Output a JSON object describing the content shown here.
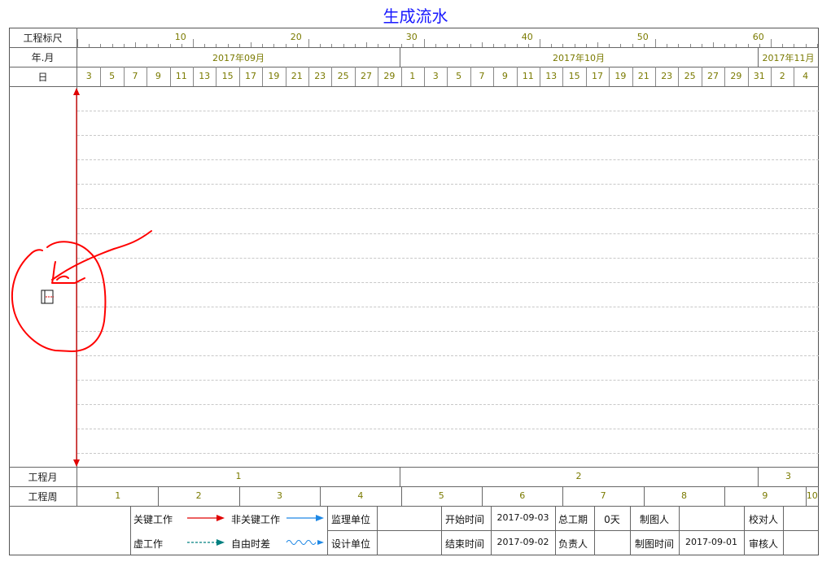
{
  "title": "生成流水",
  "row_labels": {
    "scale": "工程标尺",
    "year_month": "年.月",
    "day": "日",
    "project_month": "工程月",
    "project_week": "工程周"
  },
  "scale_ticks": [
    "10",
    "20",
    "30",
    "40",
    "50",
    "60"
  ],
  "months": [
    "2017年09月",
    "2017年10月",
    "2017年11月"
  ],
  "days": [
    "3",
    "5",
    "7",
    "9",
    "11",
    "13",
    "15",
    "17",
    "19",
    "21",
    "23",
    "25",
    "27",
    "29",
    "1",
    "3",
    "5",
    "7",
    "9",
    "11",
    "13",
    "15",
    "17",
    "19",
    "21",
    "23",
    "25",
    "27",
    "29",
    "31",
    "2",
    "4"
  ],
  "project_months": [
    "1",
    "2",
    "3"
  ],
  "project_weeks": [
    "1",
    "2",
    "3",
    "4",
    "5",
    "6",
    "7",
    "8",
    "9",
    "10"
  ],
  "legend": {
    "critical": "关键工作",
    "noncritical": "非关键工作",
    "dummy": "虚工作",
    "free_float": "自由时差",
    "supervisor": "监理单位",
    "designer": "设计单位",
    "start_label": "开始时间",
    "start_value": "2017-09-03",
    "end_label": "结束时间",
    "end_value": "2017-09-02",
    "duration_label": "总工期",
    "duration_value": "0天",
    "owner_label": "负责人",
    "drafter_label": "制图人",
    "draft_time_label": "制图时间",
    "draft_time_value": "2017-09-01",
    "checker_label": "校对人",
    "reviewer_label": "审核人"
  },
  "colors": {
    "title": "#1a1aff",
    "critical": "#e00000",
    "noncritical": "#1e88e5",
    "dummy": "#008080",
    "annotation": "#ff0000"
  }
}
